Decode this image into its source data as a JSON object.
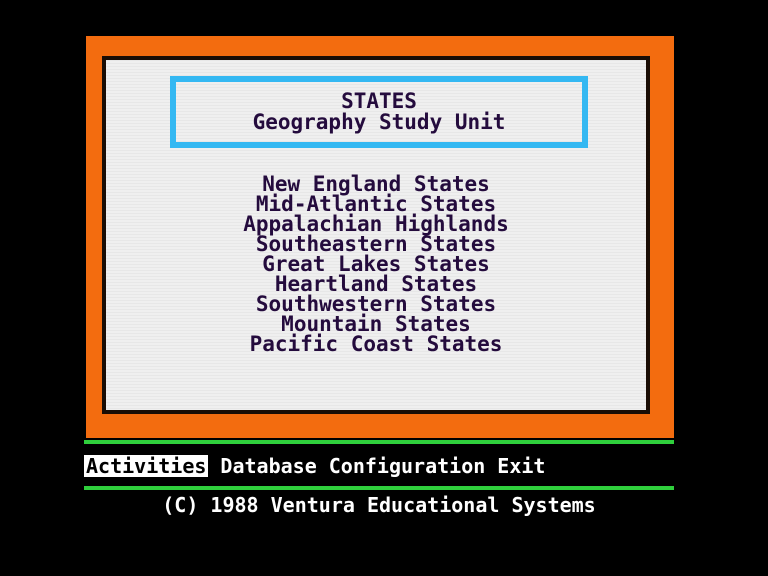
{
  "title_box": {
    "title": "STATES",
    "subtitle": "Geography Study Unit"
  },
  "regions": [
    "New England States",
    "Mid-Atlantic States",
    "Appalachian Highlands",
    "Southeastern States",
    "Great Lakes States",
    "Heartland States",
    "Southwestern States",
    "Mountain States",
    "Pacific Coast States"
  ],
  "menu_bar": {
    "activities": "Activities",
    "database": "Database",
    "configuration": "Configuration",
    "exit": "Exit"
  },
  "footer": {
    "copyright": "(C) 1988 Ventura Educational Systems"
  },
  "colors": {
    "frame": "#f36c0f",
    "title_border": "#34b8f2",
    "text": "#240b3d",
    "rule": "#2fcf3c"
  }
}
